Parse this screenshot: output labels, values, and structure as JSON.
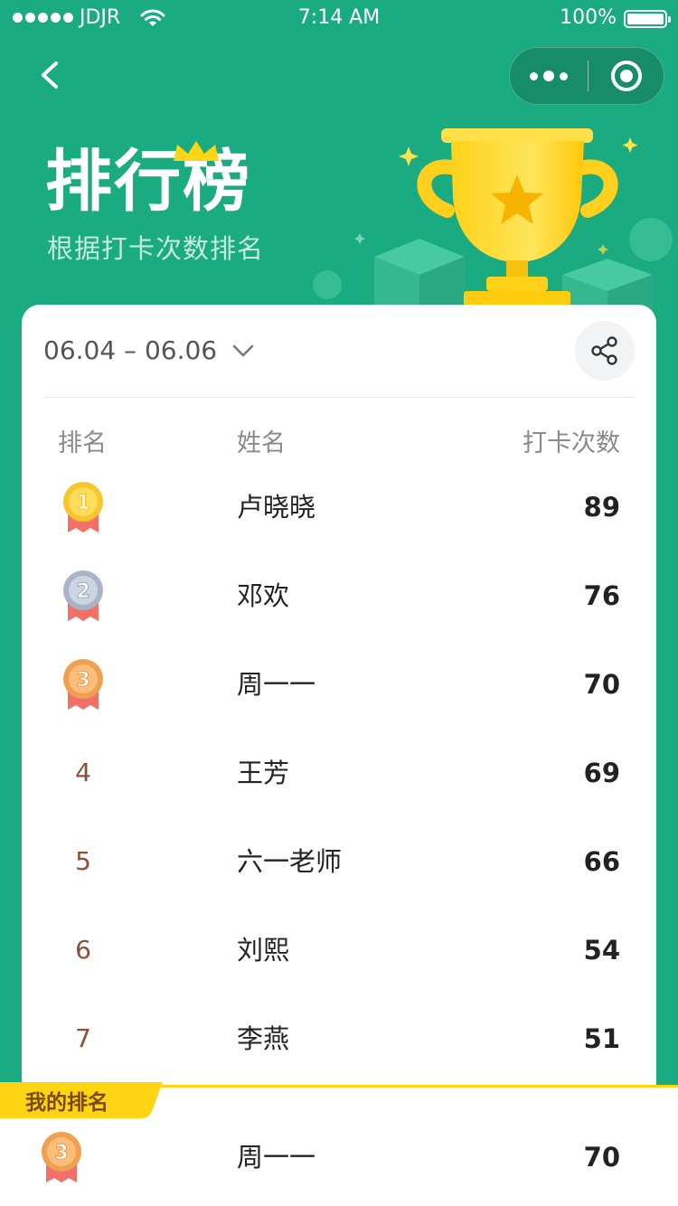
{
  "status_bar": {
    "carrier": "JDJR",
    "time": "7:14 AM",
    "battery": "100%"
  },
  "nav": {
    "back_icon": "chevron-left-icon",
    "more_icon": "more-dots-icon",
    "close_icon": "target-circle-icon"
  },
  "header": {
    "title": "排行榜",
    "subtitle": "根据打卡次数排名"
  },
  "colors": {
    "brand_green": "#1bab80",
    "accent_yellow": "#ffd414",
    "rank_text": "#8b4f3a",
    "gold": "#f7c52c",
    "silver": "#aab4c8",
    "bronze": "#f0a052"
  },
  "card": {
    "date_range": "06.04 – 06.06",
    "share_icon": "share-icon",
    "columns": {
      "rank": "排名",
      "name": "姓名",
      "count": "打卡次数"
    },
    "rows": [
      {
        "rank": "1",
        "medal": "gold",
        "name": "卢晓晓",
        "count": "89"
      },
      {
        "rank": "2",
        "medal": "silver",
        "name": "邓欢",
        "count": "76"
      },
      {
        "rank": "3",
        "medal": "bronze",
        "name": "周一一",
        "count": "70"
      },
      {
        "rank": "4",
        "medal": "",
        "name": "王芳",
        "count": "69"
      },
      {
        "rank": "5",
        "medal": "",
        "name": "六一老师",
        "count": "66"
      },
      {
        "rank": "6",
        "medal": "",
        "name": "刘熙",
        "count": "54"
      },
      {
        "rank": "7",
        "medal": "",
        "name": "李燕",
        "count": "51"
      }
    ]
  },
  "my_rank": {
    "label": "我的排名",
    "rank": "3",
    "medal": "bronze",
    "name": "周一一",
    "count": "70"
  }
}
